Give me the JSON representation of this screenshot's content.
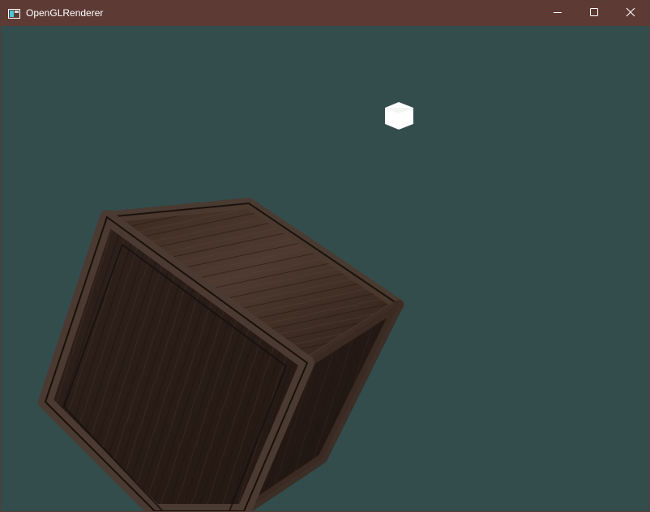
{
  "window": {
    "title": "OpenGLRenderer"
  },
  "titlebar": {
    "background": "#5e3a34",
    "icons": {
      "app": "app-window-icon",
      "minimize": "minimize-icon",
      "maximize": "maximize-icon",
      "close": "close-icon"
    }
  },
  "scene": {
    "clear_color": "#334d4d",
    "objects": [
      {
        "name": "light-source-cube",
        "color": "#ffffff"
      },
      {
        "name": "wooden-crate",
        "color": "#3a2a22"
      }
    ]
  }
}
